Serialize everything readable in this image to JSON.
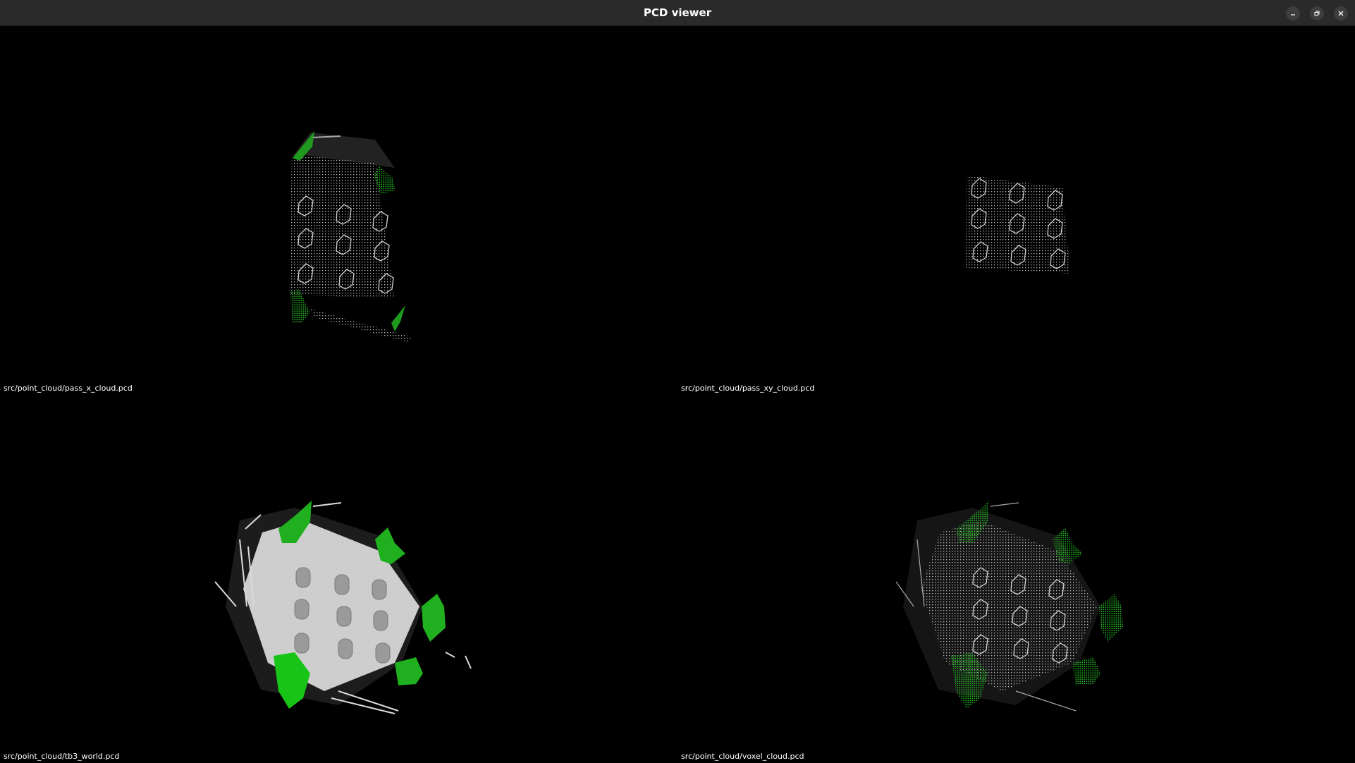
{
  "window": {
    "title": "PCD viewer",
    "controls": [
      {
        "name": "minimize",
        "icon": "minimize-icon"
      },
      {
        "name": "maximize",
        "icon": "restore-icon"
      },
      {
        "name": "close",
        "icon": "close-icon"
      }
    ]
  },
  "viewports": [
    {
      "id": "top-left",
      "file": "src/point_cloud/pass_x_cloud.pcd",
      "style": "sparse-with-walls"
    },
    {
      "id": "top-right",
      "file": "src/point_cloud/pass_xy_cloud.pcd",
      "style": "sparse-plate-only"
    },
    {
      "id": "bottom-left",
      "file": "src/point_cloud/tb3_world.pcd",
      "style": "dense-hexagon"
    },
    {
      "id": "bottom-right",
      "file": "src/point_cloud/voxel_cloud.pcd",
      "style": "sparse-hexagon"
    }
  ],
  "colors": {
    "background": "#000000",
    "titlebar": "#2a2a2a",
    "points_white": "#d0d0d0",
    "points_green": "#22b022",
    "label_text": "#ffffff"
  }
}
